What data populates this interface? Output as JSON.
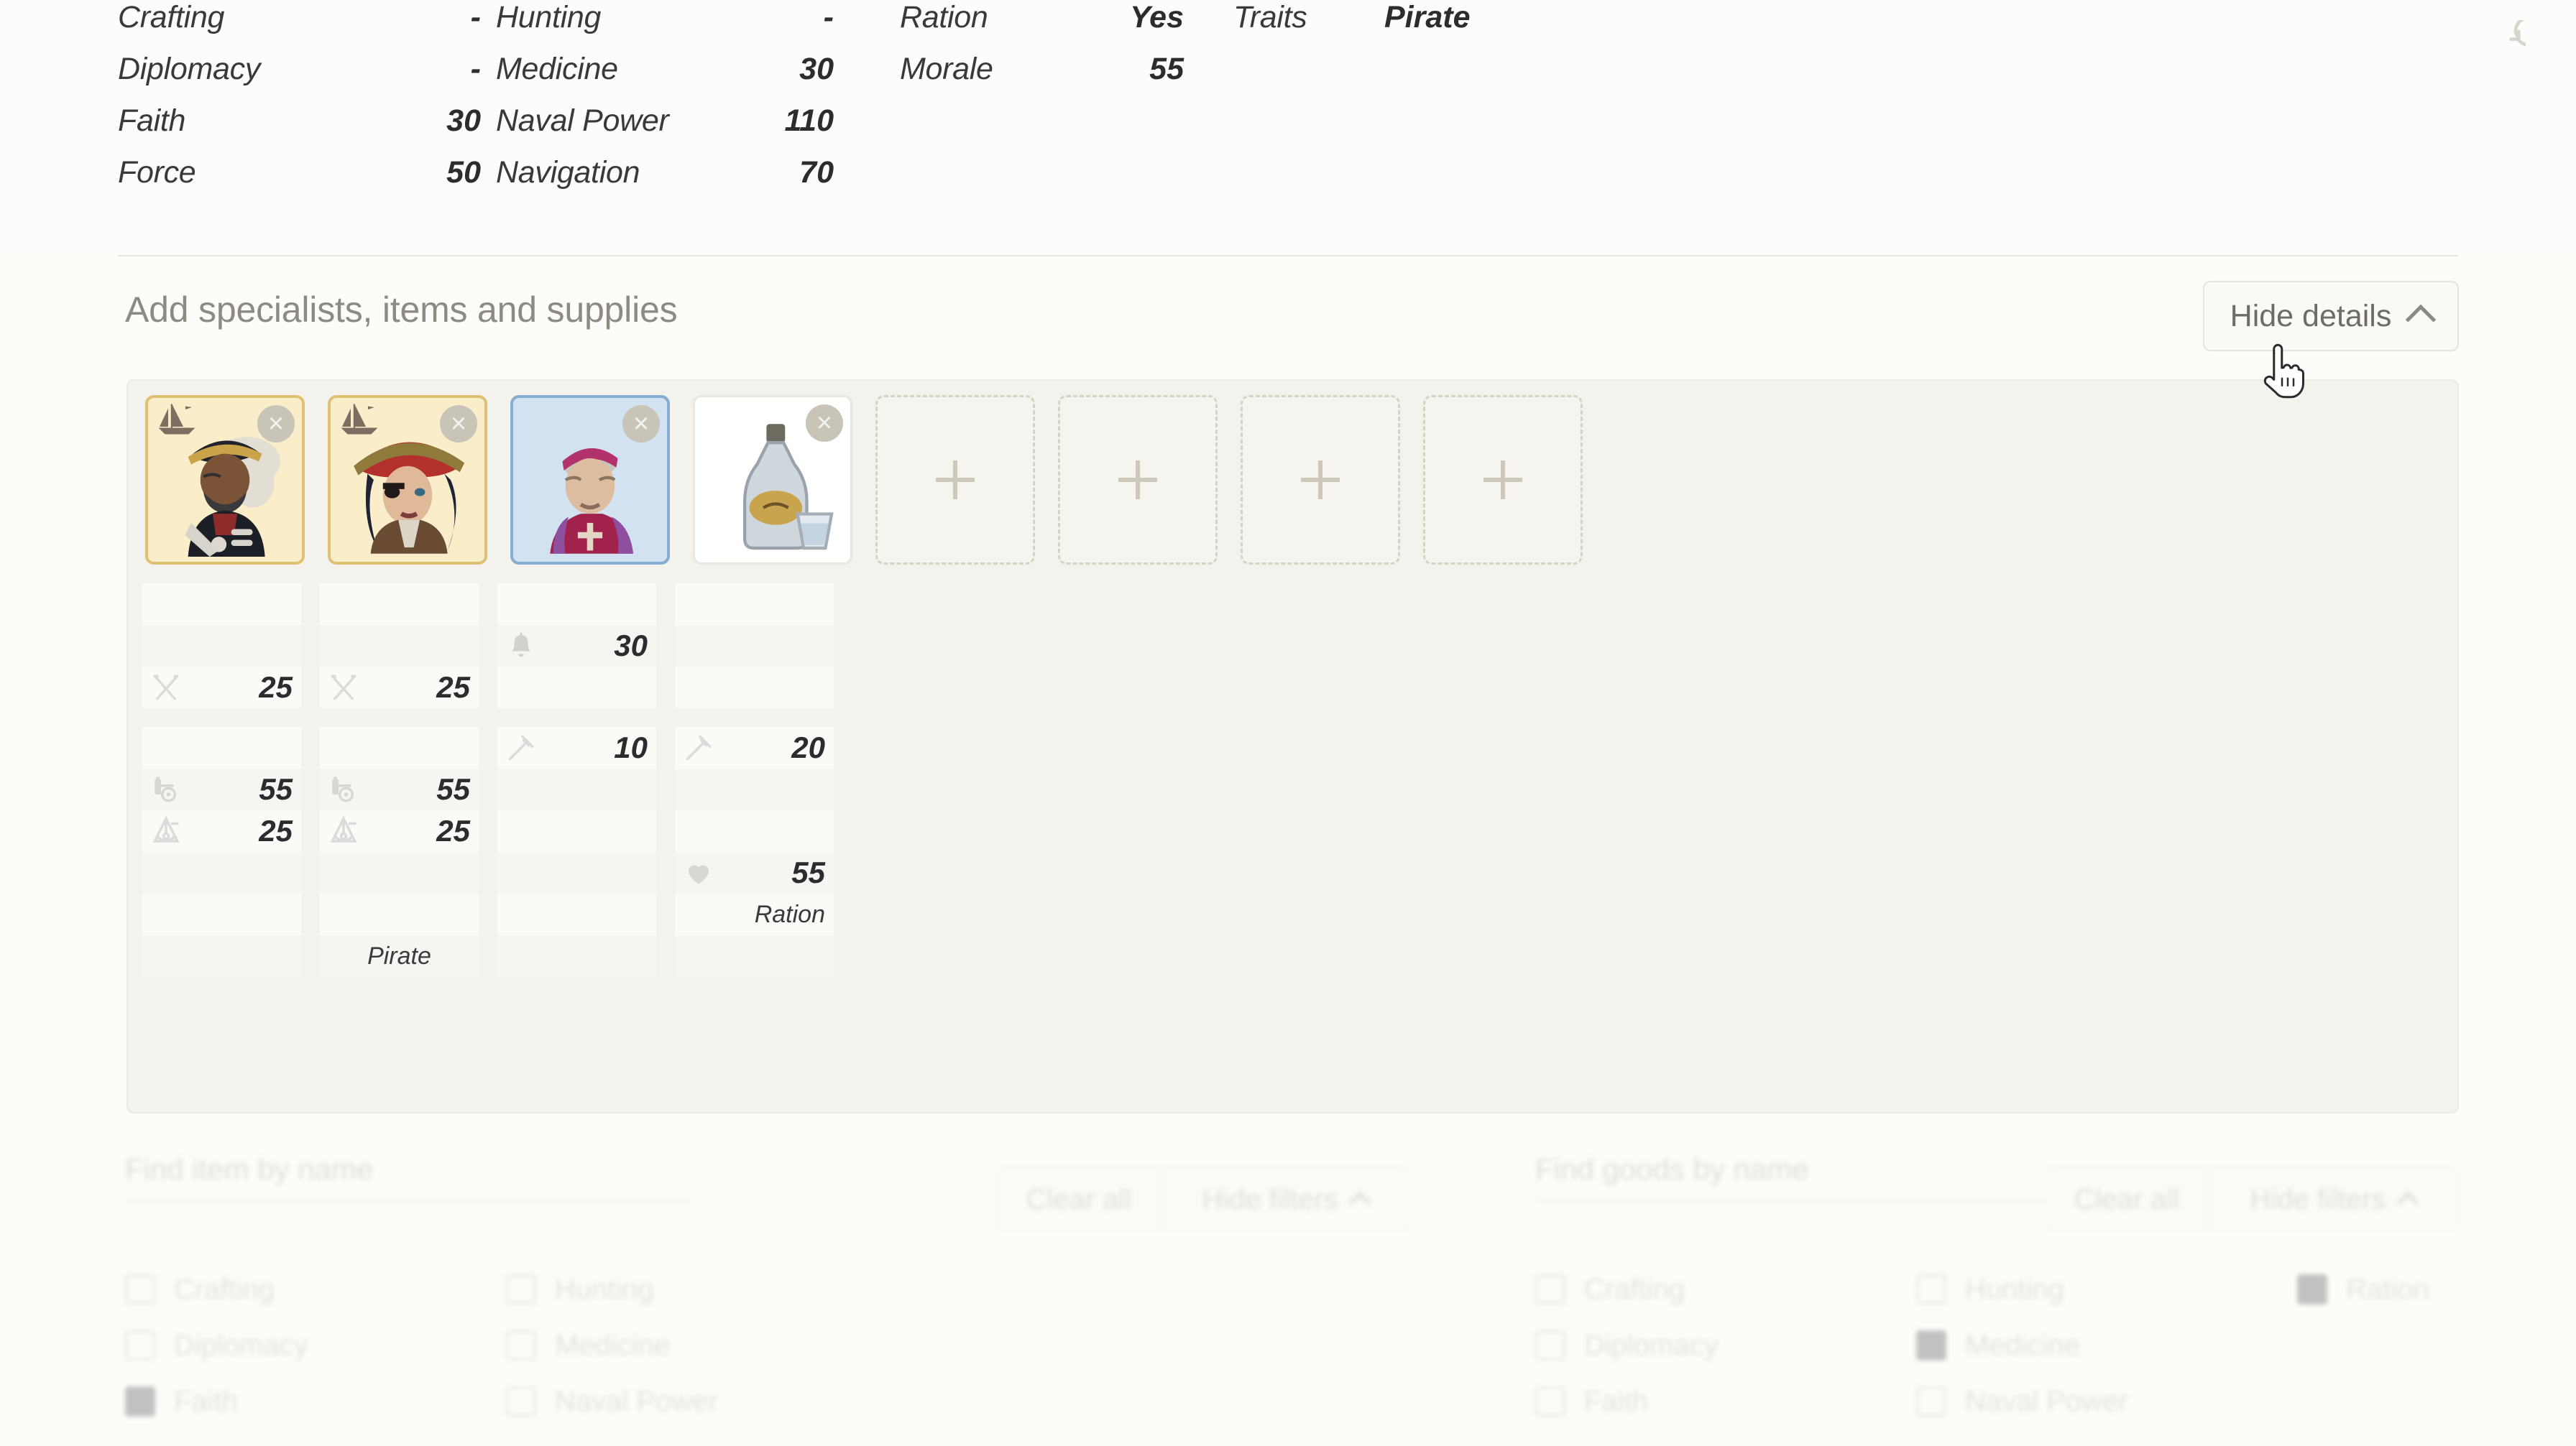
{
  "stats": {
    "column_a": [
      {
        "label": "Crafting",
        "value": "-"
      },
      {
        "label": "Diplomacy",
        "value": "-"
      },
      {
        "label": "Faith",
        "value": "30"
      },
      {
        "label": "Force",
        "value": "50"
      }
    ],
    "column_b": [
      {
        "label": "Hunting",
        "value": "-"
      },
      {
        "label": "Medicine",
        "value": "30"
      },
      {
        "label": "Naval Power",
        "value": "110"
      },
      {
        "label": "Navigation",
        "value": "70"
      }
    ],
    "column_c": [
      {
        "label": "Ration",
        "value": "Yes"
      },
      {
        "label": "Morale",
        "value": "55"
      }
    ],
    "column_d": [
      {
        "label": "Traits",
        "value": "Pirate"
      }
    ],
    "reset_icon": "refresh-icon"
  },
  "section": {
    "title": "Add specialists, items and supplies",
    "hide_details_label": "Hide details",
    "hide_details_icon": "chevron-up-icon"
  },
  "slots": [
    {
      "kind": "specialist",
      "icon": "officer-portrait",
      "badge": "ship-icon",
      "remove_label": "×",
      "selected": false
    },
    {
      "kind": "specialist",
      "icon": "pirate-portrait",
      "badge": "ship-icon",
      "remove_label": "×",
      "selected": false
    },
    {
      "kind": "specialist",
      "icon": "bishop-portrait",
      "badge": null,
      "remove_label": "×",
      "selected": true
    },
    {
      "kind": "item",
      "icon": "rum-bottle-icon",
      "badge": null,
      "remove_label": "×",
      "selected": false
    },
    {
      "kind": "empty",
      "add_label": "+"
    },
    {
      "kind": "empty",
      "add_label": "+"
    },
    {
      "kind": "empty",
      "add_label": "+"
    },
    {
      "kind": "empty",
      "add_label": "+"
    }
  ],
  "stat_grid": {
    "rows": [
      {
        "alt": false,
        "cells": [
          {
            "t": "blank"
          },
          {
            "t": "blank"
          },
          {
            "t": "blank"
          },
          {
            "t": "blank"
          }
        ]
      },
      {
        "alt": true,
        "cells": [
          {
            "t": "void"
          },
          {
            "t": "void"
          },
          {
            "t": "val",
            "icon": "faith-bell-icon",
            "value": "30"
          },
          {
            "t": "void"
          }
        ]
      },
      {
        "alt": false,
        "cells": [
          {
            "t": "val",
            "icon": "force-swords-icon",
            "value": "25"
          },
          {
            "t": "val",
            "icon": "force-swords-icon",
            "value": "25"
          },
          {
            "t": "blank"
          },
          {
            "t": "blank"
          }
        ]
      },
      {
        "alt": false,
        "cells": [
          {
            "t": "blank"
          },
          {
            "t": "blank"
          },
          {
            "t": "val",
            "icon": "medicine-syringe-icon",
            "value": "10"
          },
          {
            "t": "val",
            "icon": "medicine-syringe-icon",
            "value": "20"
          }
        ]
      },
      {
        "alt": true,
        "cells": [
          {
            "t": "val",
            "icon": "naval-cannon-icon",
            "value": "55"
          },
          {
            "t": "val",
            "icon": "naval-cannon-icon",
            "value": "55"
          },
          {
            "t": "void"
          },
          {
            "t": "void"
          }
        ]
      },
      {
        "alt": false,
        "cells": [
          {
            "t": "val",
            "icon": "navigation-sextant-icon",
            "value": "25"
          },
          {
            "t": "val",
            "icon": "navigation-sextant-icon",
            "value": "25"
          },
          {
            "t": "blank"
          },
          {
            "t": "blank"
          }
        ]
      },
      {
        "alt": true,
        "cells": [
          {
            "t": "void"
          },
          {
            "t": "void"
          },
          {
            "t": "void"
          },
          {
            "t": "val",
            "icon": "morale-heart-icon",
            "value": "55"
          }
        ]
      },
      {
        "alt": false,
        "cells": [
          {
            "t": "blank"
          },
          {
            "t": "blank"
          },
          {
            "t": "blank"
          },
          {
            "t": "text",
            "value": "Ration"
          }
        ]
      },
      {
        "alt": true,
        "cells": [
          {
            "t": "void"
          },
          {
            "t": "textc",
            "value": "Pirate"
          },
          {
            "t": "void"
          },
          {
            "t": "void"
          }
        ]
      }
    ]
  },
  "filters": {
    "left": {
      "search_placeholder": "Find item by name",
      "checkbox_columns": [
        [
          {
            "label": "Crafting",
            "checked": false
          },
          {
            "label": "Diplomacy",
            "checked": false
          },
          {
            "label": "Faith",
            "checked": true
          }
        ],
        [
          {
            "label": "Hunting",
            "checked": false
          },
          {
            "label": "Medicine",
            "checked": false
          },
          {
            "label": "Naval Power",
            "checked": false
          }
        ]
      ],
      "clear_all_label": "Clear all",
      "hide_filters_label": "Hide filters"
    },
    "right": {
      "search_placeholder": "Find goods by name",
      "checkbox_columns": [
        [
          {
            "label": "Crafting",
            "checked": false
          },
          {
            "label": "Diplomacy",
            "checked": false
          },
          {
            "label": "Faith",
            "checked": false
          }
        ],
        [
          {
            "label": "Hunting",
            "checked": false
          },
          {
            "label": "Medicine",
            "checked": true
          },
          {
            "label": "Naval Power",
            "checked": false
          }
        ],
        [
          {
            "label": "Ration",
            "checked": true
          }
        ]
      ],
      "clear_all_label": "Clear all",
      "hide_filters_label": "Hide filters"
    }
  },
  "cursor": {
    "icon": "pointer-hand-cursor"
  },
  "colors": {
    "background": "#fdfcf9",
    "panel": "#f4f2ed",
    "specialist_card": "#f9eec9",
    "specialist_border": "#dfc173",
    "selected_card": "#d2e2f1",
    "selected_border": "#86aed2",
    "text_dark": "#2c2c2d",
    "text_muted": "#8d8a84"
  }
}
